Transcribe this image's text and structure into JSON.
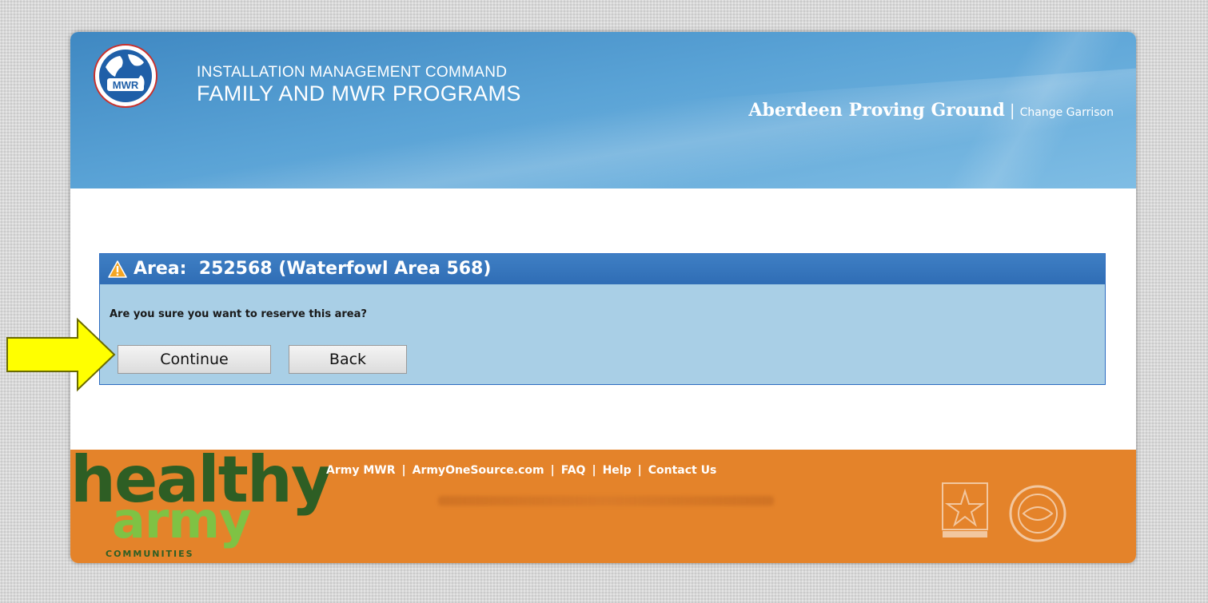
{
  "header": {
    "logo_text": "MWR",
    "command_line1": "INSTALLATION MANAGEMENT COMMAND",
    "command_line2": "FAMILY AND MWR PROGRAMS",
    "garrison_name": "Aberdeen Proving Ground",
    "separator": "|",
    "change_garrison_label": "Change Garrison"
  },
  "dialog": {
    "title": "Area:  252568 (Waterfowl Area 568)",
    "message": "Are you sure you want to reserve this area?",
    "continue_label": "Continue",
    "back_label": "Back",
    "icon": "warning-icon"
  },
  "annotation": {
    "icon": "arrow-right-icon",
    "color": "#ffff00"
  },
  "footer": {
    "brand_healthy": "healthy",
    "brand_army": "army",
    "brand_communities": "COMMUNITIES",
    "links": [
      "Army MWR",
      "ArmyOneSource.com",
      "FAQ",
      "Help",
      "Contact Us"
    ],
    "link_separator": "|",
    "emblems": [
      "us-army-star-icon",
      "imcom-seal-icon"
    ]
  },
  "colors": {
    "header_blue": "#4a94cd",
    "dialog_title_bg": "#2f6db5",
    "dialog_body_bg": "#a9cfe6",
    "footer_orange": "#e4832a",
    "healthy_green": "#2e5e24",
    "army_green": "#7fc244"
  }
}
